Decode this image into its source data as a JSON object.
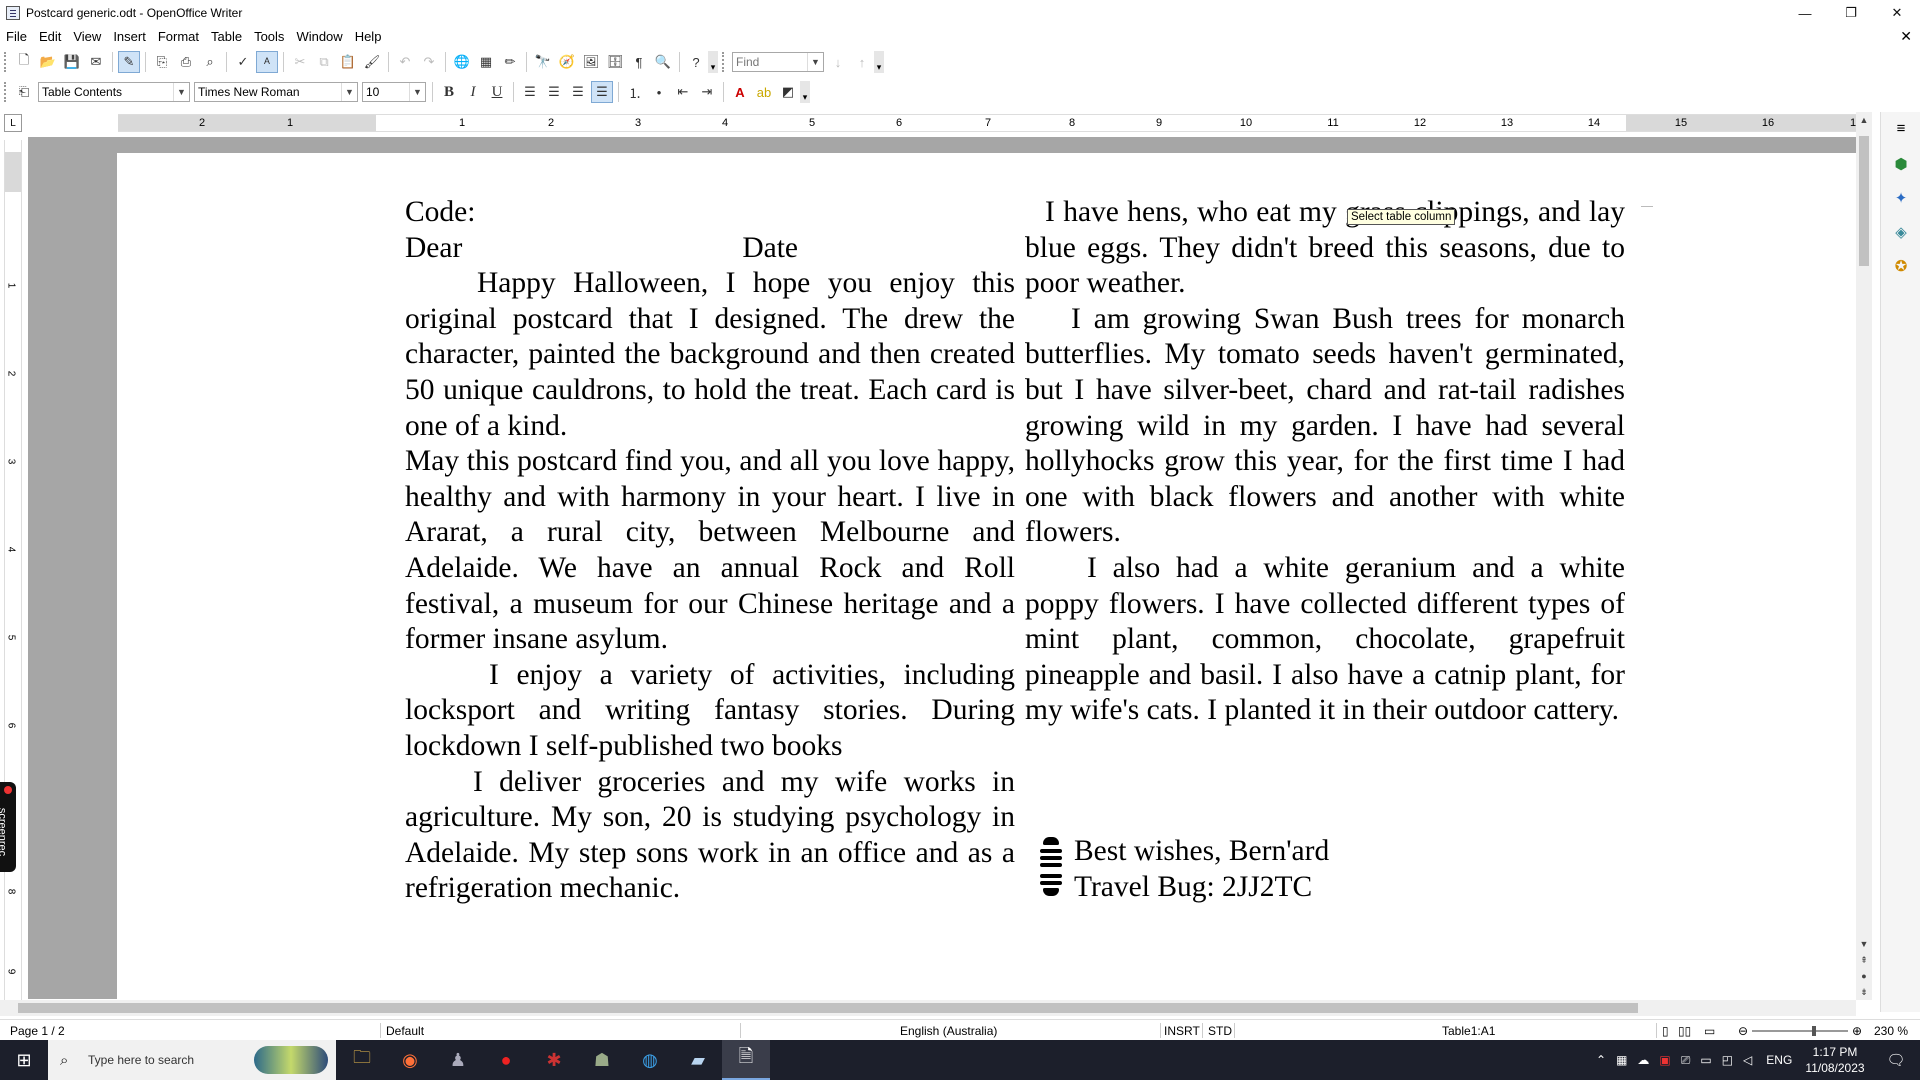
{
  "window": {
    "title": "Postcard generic.odt - OpenOffice Writer",
    "controls": {
      "minimize": "—",
      "maximize": "❐",
      "close": "✕"
    }
  },
  "menu": {
    "items": [
      "File",
      "Edit",
      "View",
      "Insert",
      "Format",
      "Table",
      "Tools",
      "Window",
      "Help"
    ],
    "close": "✕"
  },
  "toolbar": {
    "find_placeholder": "Find",
    "paragraph_style": "Table Contents",
    "font_name": "Times New Roman",
    "font_size": "10",
    "bold": "B",
    "italic": "I",
    "underline": "U"
  },
  "ruler": {
    "corner": "L",
    "ticks": [
      "2",
      "1",
      "1",
      "2",
      "3",
      "4",
      "5",
      "6",
      "7",
      "8",
      "9",
      "10",
      "11",
      "12",
      "13",
      "14",
      "15",
      "16",
      "1"
    ],
    "vticks": [
      "1",
      "2",
      "3",
      "4",
      "5",
      "6",
      "7",
      "8",
      "9"
    ]
  },
  "document": {
    "left_column": {
      "code_label": "Code:",
      "dear": "Dear",
      "date": "Date",
      "p1": "Happy Halloween, I hope you enjoy this original postcard that I designed. The drew the character, painted the background and then created 50 unique cauldrons, to hold the treat. Each card is one of a kind.",
      "p2": "May this postcard find you, and all you love happy, healthy and with harmony in your heart. I live in Ararat, a rural city, between Melbourne and Adelaide. We have an annual Rock and Roll festival, a museum for our Chinese heritage and a former insane asylum.",
      "p3": "I enjoy a variety of activities, including locksport and writing fantasy stories. During lockdown I self-published two books",
      "p4": "I deliver groceries and my wife works in agriculture. My son, 20 is studying psychology in Adelaide. My step sons work in an office and as a refrigeration mechanic."
    },
    "right_column": {
      "p1": "I have hens, who eat my grass clippings, and lay blue eggs. They didn't breed this seasons, due to poor weather.",
      "p2": "I am growing Swan Bush trees for monarch butterflies. My tomato seeds haven't germinated, but I have silver-beet, chard and rat-tail radishes growing wild in my garden. I have had several hollyhocks grow this year, for the first time I had one with black flowers and another with white flowers.",
      "p3": "I also had a white geranium and a white poppy flowers. I have collected different types of mint plant, common, chocolate, grapefruit pineapple and basil. I also have a catnip plant, for my wife's cats. I planted it in their outdoor cattery."
    },
    "signature": {
      "line1": "Best wishes, Bern'ard",
      "line2": "Travel Bug: 2JJ2TC"
    },
    "tooltip": "Select table column"
  },
  "status": {
    "page": "Page 1 / 2",
    "page_style": "Default",
    "language": "English (Australia)",
    "insert_mode": "INSRT",
    "selection_mode": "STD",
    "cell": "Table1:A1",
    "zoom": "230 %"
  },
  "taskbar": {
    "search_placeholder": "Type here to search",
    "language": "ENG",
    "time": "1:17 PM",
    "date": "11/08/2023",
    "screenrec_label": "screenrec"
  },
  "colors": {
    "doc_background": "#a6a6a6",
    "taskbar": "#1c1f2b",
    "tooltip": "#ffffe1"
  }
}
